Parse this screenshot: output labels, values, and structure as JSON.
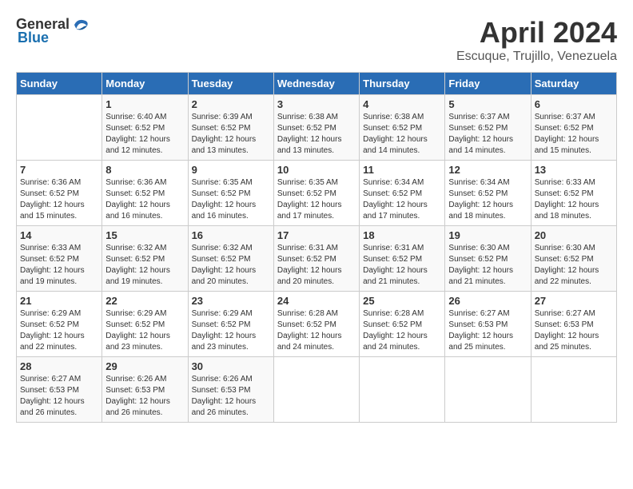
{
  "logo": {
    "text_general": "General",
    "text_blue": "Blue"
  },
  "title": {
    "month": "April 2024",
    "location": "Escuque, Trujillo, Venezuela"
  },
  "headers": [
    "Sunday",
    "Monday",
    "Tuesday",
    "Wednesday",
    "Thursday",
    "Friday",
    "Saturday"
  ],
  "weeks": [
    [
      {
        "day": "",
        "detail": ""
      },
      {
        "day": "1",
        "detail": "Sunrise: 6:40 AM\nSunset: 6:52 PM\nDaylight: 12 hours\nand 12 minutes."
      },
      {
        "day": "2",
        "detail": "Sunrise: 6:39 AM\nSunset: 6:52 PM\nDaylight: 12 hours\nand 13 minutes."
      },
      {
        "day": "3",
        "detail": "Sunrise: 6:38 AM\nSunset: 6:52 PM\nDaylight: 12 hours\nand 13 minutes."
      },
      {
        "day": "4",
        "detail": "Sunrise: 6:38 AM\nSunset: 6:52 PM\nDaylight: 12 hours\nand 14 minutes."
      },
      {
        "day": "5",
        "detail": "Sunrise: 6:37 AM\nSunset: 6:52 PM\nDaylight: 12 hours\nand 14 minutes."
      },
      {
        "day": "6",
        "detail": "Sunrise: 6:37 AM\nSunset: 6:52 PM\nDaylight: 12 hours\nand 15 minutes."
      }
    ],
    [
      {
        "day": "7",
        "detail": "Sunrise: 6:36 AM\nSunset: 6:52 PM\nDaylight: 12 hours\nand 15 minutes."
      },
      {
        "day": "8",
        "detail": "Sunrise: 6:36 AM\nSunset: 6:52 PM\nDaylight: 12 hours\nand 16 minutes."
      },
      {
        "day": "9",
        "detail": "Sunrise: 6:35 AM\nSunset: 6:52 PM\nDaylight: 12 hours\nand 16 minutes."
      },
      {
        "day": "10",
        "detail": "Sunrise: 6:35 AM\nSunset: 6:52 PM\nDaylight: 12 hours\nand 17 minutes."
      },
      {
        "day": "11",
        "detail": "Sunrise: 6:34 AM\nSunset: 6:52 PM\nDaylight: 12 hours\nand 17 minutes."
      },
      {
        "day": "12",
        "detail": "Sunrise: 6:34 AM\nSunset: 6:52 PM\nDaylight: 12 hours\nand 18 minutes."
      },
      {
        "day": "13",
        "detail": "Sunrise: 6:33 AM\nSunset: 6:52 PM\nDaylight: 12 hours\nand 18 minutes."
      }
    ],
    [
      {
        "day": "14",
        "detail": "Sunrise: 6:33 AM\nSunset: 6:52 PM\nDaylight: 12 hours\nand 19 minutes."
      },
      {
        "day": "15",
        "detail": "Sunrise: 6:32 AM\nSunset: 6:52 PM\nDaylight: 12 hours\nand 19 minutes."
      },
      {
        "day": "16",
        "detail": "Sunrise: 6:32 AM\nSunset: 6:52 PM\nDaylight: 12 hours\nand 20 minutes."
      },
      {
        "day": "17",
        "detail": "Sunrise: 6:31 AM\nSunset: 6:52 PM\nDaylight: 12 hours\nand 20 minutes."
      },
      {
        "day": "18",
        "detail": "Sunrise: 6:31 AM\nSunset: 6:52 PM\nDaylight: 12 hours\nand 21 minutes."
      },
      {
        "day": "19",
        "detail": "Sunrise: 6:30 AM\nSunset: 6:52 PM\nDaylight: 12 hours\nand 21 minutes."
      },
      {
        "day": "20",
        "detail": "Sunrise: 6:30 AM\nSunset: 6:52 PM\nDaylight: 12 hours\nand 22 minutes."
      }
    ],
    [
      {
        "day": "21",
        "detail": "Sunrise: 6:29 AM\nSunset: 6:52 PM\nDaylight: 12 hours\nand 22 minutes."
      },
      {
        "day": "22",
        "detail": "Sunrise: 6:29 AM\nSunset: 6:52 PM\nDaylight: 12 hours\nand 23 minutes."
      },
      {
        "day": "23",
        "detail": "Sunrise: 6:29 AM\nSunset: 6:52 PM\nDaylight: 12 hours\nand 23 minutes."
      },
      {
        "day": "24",
        "detail": "Sunrise: 6:28 AM\nSunset: 6:52 PM\nDaylight: 12 hours\nand 24 minutes."
      },
      {
        "day": "25",
        "detail": "Sunrise: 6:28 AM\nSunset: 6:52 PM\nDaylight: 12 hours\nand 24 minutes."
      },
      {
        "day": "26",
        "detail": "Sunrise: 6:27 AM\nSunset: 6:53 PM\nDaylight: 12 hours\nand 25 minutes."
      },
      {
        "day": "27",
        "detail": "Sunrise: 6:27 AM\nSunset: 6:53 PM\nDaylight: 12 hours\nand 25 minutes."
      }
    ],
    [
      {
        "day": "28",
        "detail": "Sunrise: 6:27 AM\nSunset: 6:53 PM\nDaylight: 12 hours\nand 26 minutes."
      },
      {
        "day": "29",
        "detail": "Sunrise: 6:26 AM\nSunset: 6:53 PM\nDaylight: 12 hours\nand 26 minutes."
      },
      {
        "day": "30",
        "detail": "Sunrise: 6:26 AM\nSunset: 6:53 PM\nDaylight: 12 hours\nand 26 minutes."
      },
      {
        "day": "",
        "detail": ""
      },
      {
        "day": "",
        "detail": ""
      },
      {
        "day": "",
        "detail": ""
      },
      {
        "day": "",
        "detail": ""
      }
    ]
  ]
}
